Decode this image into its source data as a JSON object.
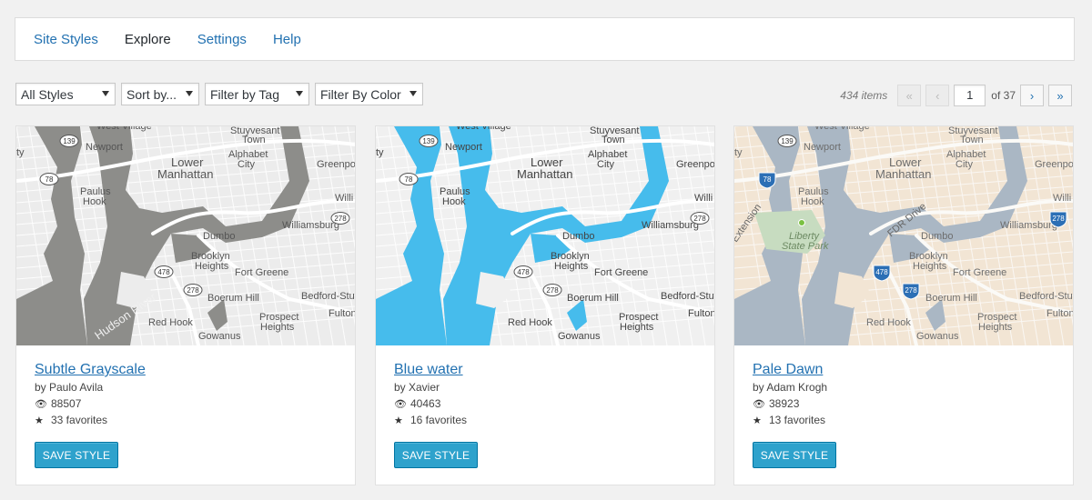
{
  "tabs": [
    {
      "label": "Site Styles",
      "active": false
    },
    {
      "label": "Explore",
      "active": true
    },
    {
      "label": "Settings",
      "active": false
    },
    {
      "label": "Help",
      "active": false
    }
  ],
  "filters": {
    "styles": "All Styles",
    "sort": "Sort by...",
    "tag": "Filter by Tag",
    "color": "Filter By Color"
  },
  "pagination": {
    "count": "434 items",
    "first": "«",
    "prev": "‹",
    "page": "1",
    "of": "of 37",
    "next": "›",
    "last": "»"
  },
  "map_labels": {
    "west_village": "West Village",
    "stuyvesant": "Stuyvesant",
    "town": "Town",
    "newport": "Newport",
    "lower": "Lower",
    "manhattan": "Manhattan",
    "alphabet": "Alphabet",
    "city": "City",
    "greenpoint": "Greenpoi",
    "paulus": "Paulus",
    "hook": "Hook",
    "williamsburg": "Williamsburg",
    "willi": "Willi",
    "dumbo": "Dumbo",
    "brooklyn": "Brooklyn",
    "heights": "Heights",
    "fort_greene": "Fort Greene",
    "boerum_hill": "Boerum Hill",
    "bedford": "Bedford-Stuy",
    "red_hook": "Red Hook",
    "prospect": "Prospect",
    "gowanus": "Gowanus",
    "fulton": "Fulton",
    "hudson_river": "Hudson River",
    "liberty": "Liberty",
    "state_park": "State Park",
    "fdr_drive": "FDR Drive",
    "extension": "Extension",
    "shield_139": "139",
    "shield_78": "78",
    "shield_278": "278",
    "shield_478": "478",
    "y_frag": "ty"
  },
  "cards": [
    {
      "title": "Subtle Grayscale",
      "author": "by Paulo Avila",
      "views": "88507",
      "favorites": "33 favorites",
      "button": "SAVE STYLE",
      "colors": {
        "land": "#ececec",
        "water": "#8d8d8a",
        "road": "#ffffff",
        "label": "#555555"
      }
    },
    {
      "title": "Blue water",
      "author": "by Xavier",
      "views": "40463",
      "favorites": "16 favorites",
      "button": "SAVE STYLE",
      "colors": {
        "land": "#f0f0f0",
        "water": "#46bcec",
        "road": "#ffffff",
        "label": "#444444"
      }
    },
    {
      "title": "Pale Dawn",
      "author": "by Adam Krogh",
      "views": "38923",
      "favorites": "13 favorites",
      "button": "SAVE STYLE",
      "colors": {
        "land": "#f2e5d4",
        "water": "#aab7c4",
        "road": "#fbfaf7",
        "label": "#6e6e6e"
      }
    }
  ],
  "icons": {
    "views": "eye-icon",
    "favorites": "star-icon"
  }
}
